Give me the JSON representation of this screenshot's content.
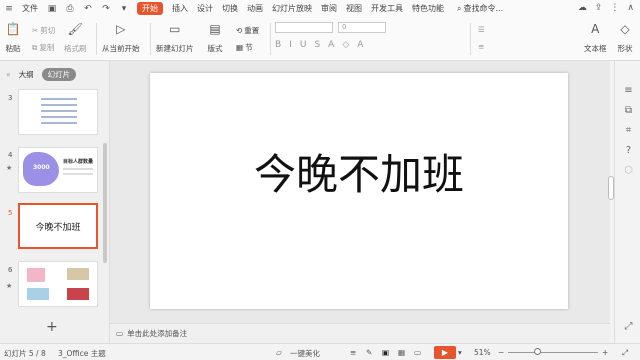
{
  "menubar": {
    "file": "文件",
    "tabs": [
      "开始",
      "插入",
      "设计",
      "切换",
      "动画",
      "幻灯片放映",
      "审阅",
      "视图",
      "开发工具",
      "特色功能"
    ],
    "search": "查找命令..."
  },
  "ribbon": {
    "paste": "粘贴",
    "cut": "剪切",
    "copy": "复制",
    "format_painter": "格式刷",
    "from_current": "从当前开始",
    "new_slide": "新建幻灯片",
    "layout": "版式",
    "section": "节",
    "reset": "重置",
    "font_size_value": "0",
    "text_box": "文本框",
    "shape": "形状"
  },
  "left_panel": {
    "outline_tab": "大纲",
    "slides_tab": "幻灯片",
    "thumbnails": [
      {
        "number": "3",
        "caption": ""
      },
      {
        "number": "4",
        "caption": "目标人群数量",
        "figure": "3000"
      },
      {
        "number": "5",
        "caption": "今晚不加班"
      },
      {
        "number": "6",
        "caption": ""
      }
    ],
    "add_label": "+"
  },
  "slide": {
    "title": "今晚不加班"
  },
  "notes": {
    "placeholder": "单击此处添加备注"
  },
  "statusbar": {
    "slide_count": "幻灯片 5 / 8",
    "theme": "3_Office 主题",
    "beautify": "一键美化",
    "zoom": "51%"
  },
  "colors": {
    "accent": "#e6562e"
  }
}
